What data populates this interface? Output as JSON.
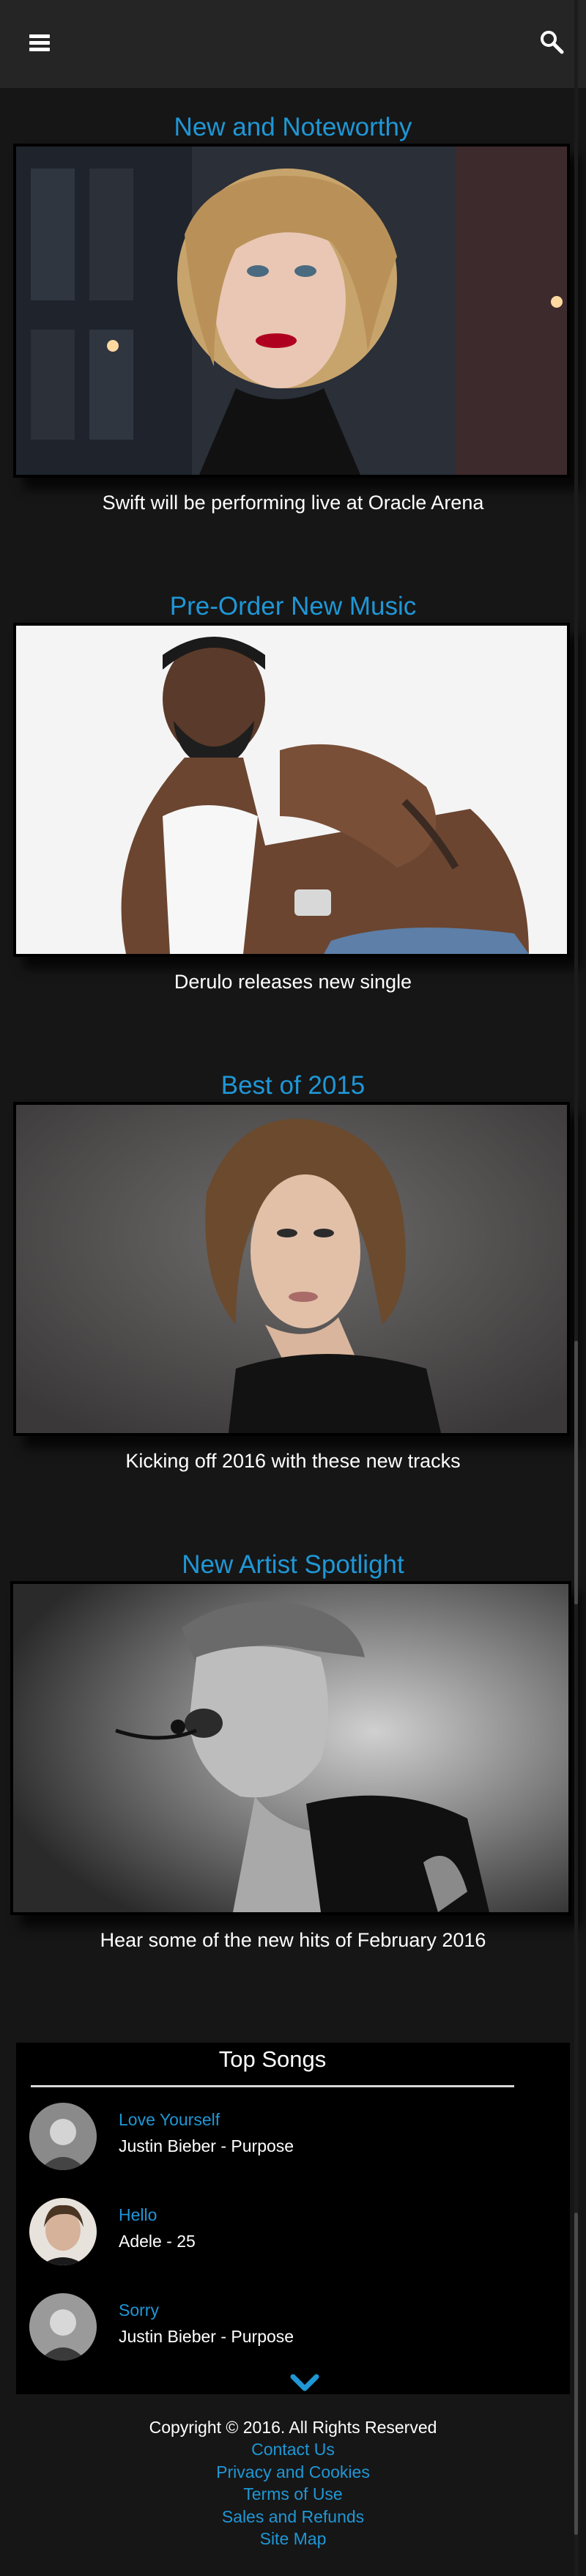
{
  "features": [
    {
      "title": "New and Noteworthy",
      "caption": "Swift will be performing live at Oracle Arena"
    },
    {
      "title": "Pre-Order New Music",
      "caption": "Derulo releases new single"
    },
    {
      "title": "Best of 2015",
      "caption": "Kicking off 2016 with these new tracks"
    },
    {
      "title": "New Artist Spotlight",
      "caption": "Hear some of the new hits of February 2016"
    }
  ],
  "top_songs": {
    "heading": "Top Songs",
    "items": [
      {
        "title": "Love Yourself",
        "artist": "Justin Bieber - Purpose"
      },
      {
        "title": "Hello",
        "artist": "Adele - 25"
      },
      {
        "title": "Sorry",
        "artist": "Justin Bieber - Purpose"
      }
    ]
  },
  "footer": {
    "copyright": "Copyright © 2016. All Rights Reserved",
    "links": [
      "Contact Us",
      "Privacy and Cookies",
      "Terms of Use",
      "Sales and Refunds",
      "Site Map"
    ]
  },
  "colors": {
    "accent": "#1f97d6",
    "background": "#161616",
    "topbar": "#252525"
  }
}
